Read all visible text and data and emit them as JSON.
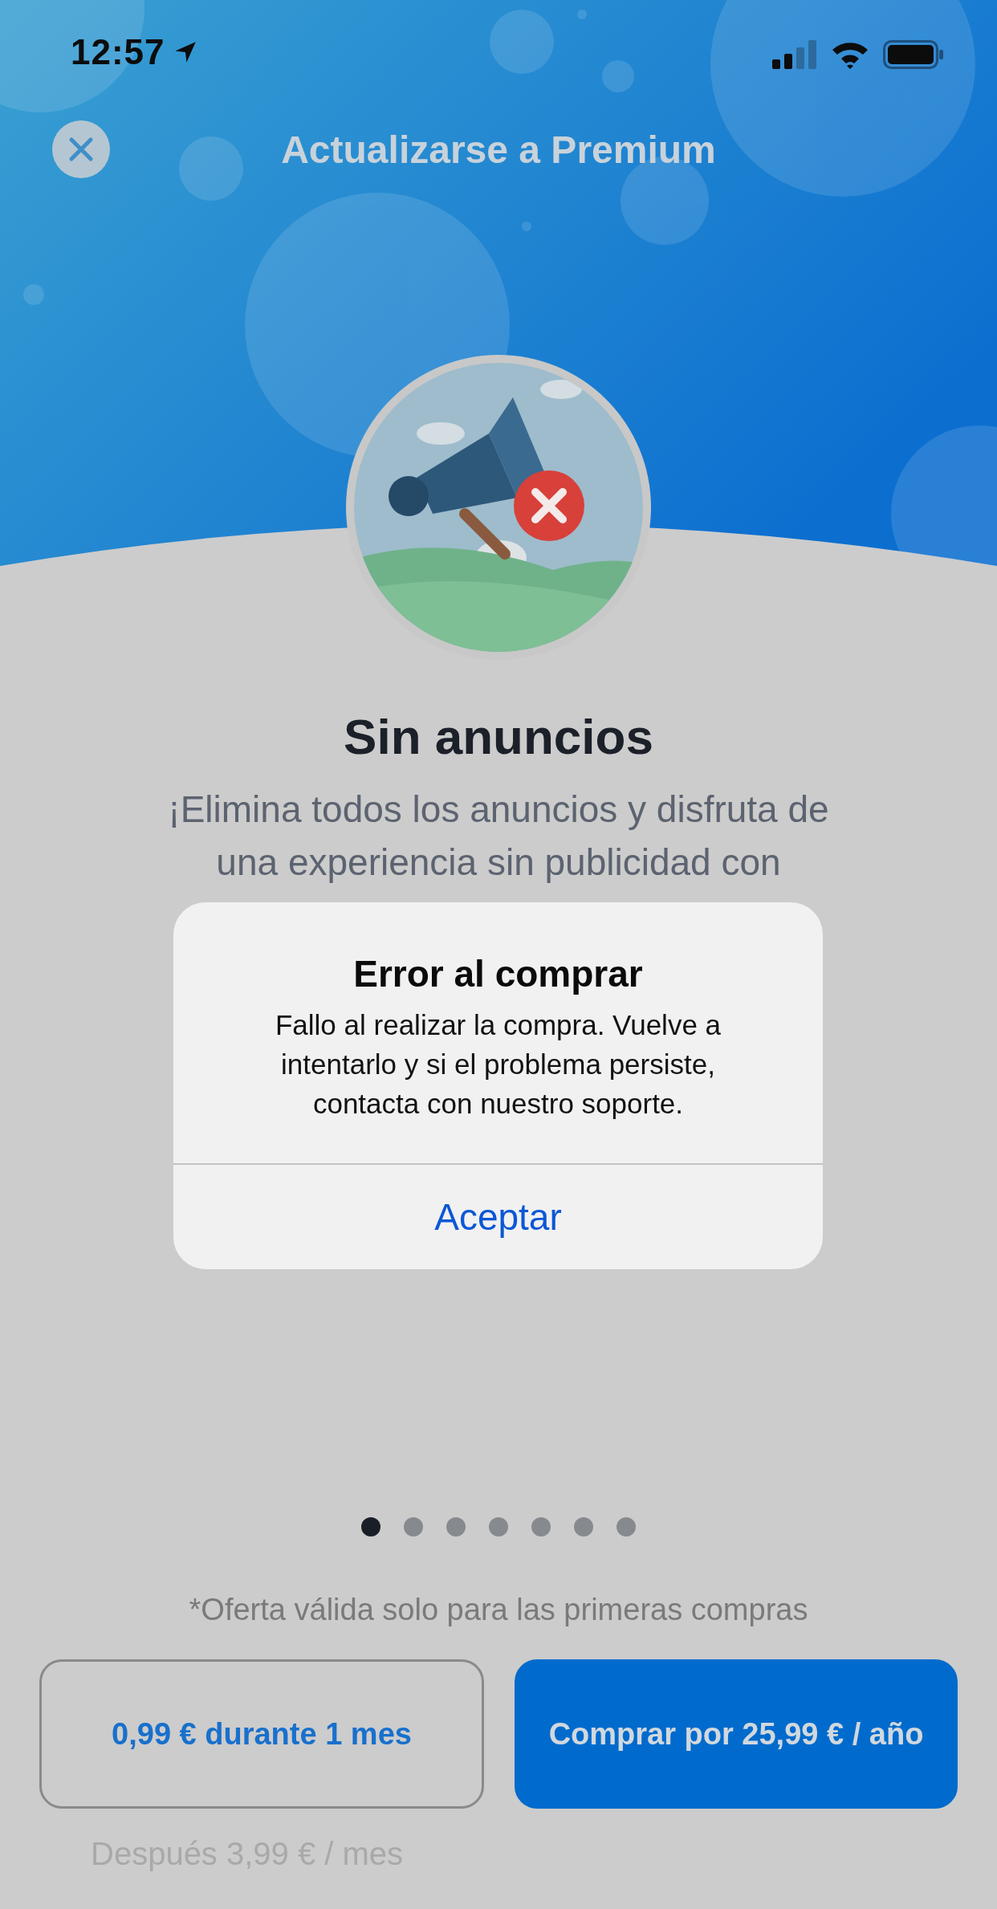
{
  "status_bar": {
    "time": "12:57"
  },
  "header": {
    "title": "Actualizarse a Premium"
  },
  "feature": {
    "title": "Sin anuncios",
    "description": "¡Elimina todos los anuncios y disfruta de una experiencia sin publicidad con"
  },
  "alert": {
    "title": "Error al comprar",
    "message": "Fallo al realizar la compra. Vuelve a intentarlo y si el problema persiste, contacta con nuestro soporte.",
    "button": "Aceptar"
  },
  "pager": {
    "dots": [
      {
        "selected": true
      },
      {
        "selected": false
      },
      {
        "selected": false
      },
      {
        "selected": false
      },
      {
        "selected": false
      },
      {
        "selected": false
      },
      {
        "selected": false
      }
    ]
  },
  "offer_note": "*Oferta válida solo para las primeras compras",
  "buttons": [
    {
      "label": "0,99 € durante 1 mes",
      "kind": "outline"
    },
    {
      "label": "Comprar por 25,99 € / año",
      "kind": "filled"
    }
  ],
  "footnote": "Después 3,99 € / mes"
}
